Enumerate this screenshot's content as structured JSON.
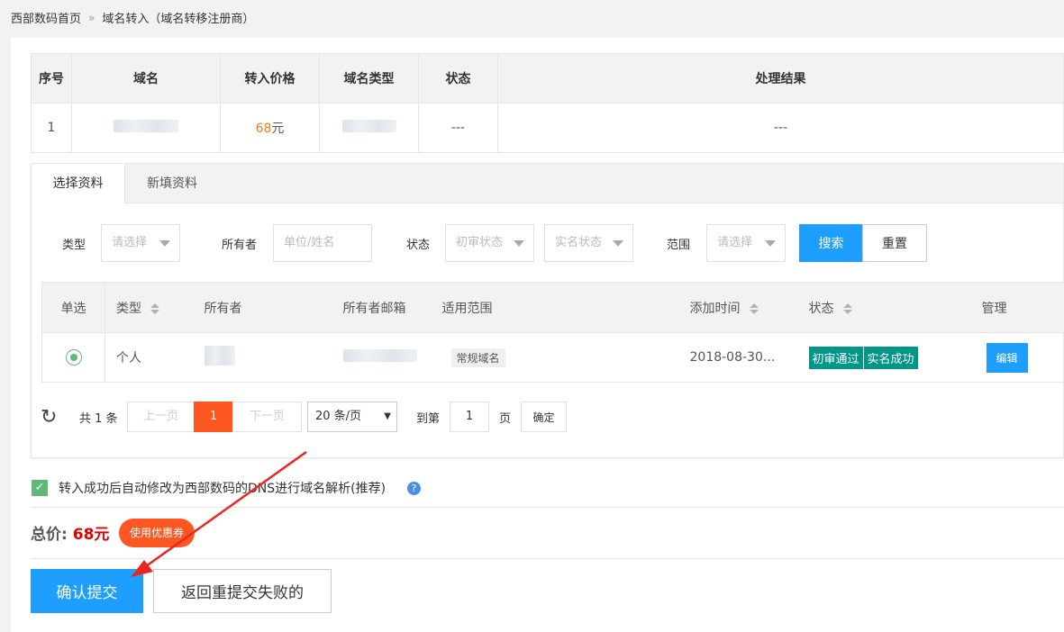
{
  "breadcrumb": {
    "home": "西部数码首页",
    "sep": "»",
    "current": "域名转入（域名转移注册商）"
  },
  "domain_table": {
    "headers": [
      "序号",
      "域名",
      "转入价格",
      "域名类型",
      "状态",
      "处理结果"
    ],
    "row": {
      "index": "1",
      "price_num": "68",
      "price_unit": "元",
      "status": "---",
      "result": "---"
    }
  },
  "tabs": [
    "选择资料",
    "新填资料"
  ],
  "filters": {
    "type_label": "类型",
    "type_placeholder": "请选择",
    "owner_label": "所有者",
    "owner_placeholder": "单位/姓名",
    "status_label": "状态",
    "status1_placeholder": "初审状态",
    "status2_placeholder": "实名状态",
    "scope_label": "范围",
    "scope_placeholder": "请选择",
    "search": "搜索",
    "reset": "重置"
  },
  "profile_table": {
    "headers": [
      "单选",
      "类型",
      "所有者",
      "所有者邮箱",
      "适用范围",
      "添加时间",
      "状态",
      "管理"
    ],
    "row": {
      "type": "个人",
      "scope": "常规域名",
      "time": "2018-08-30...",
      "status1": "初审通过",
      "status2": "实名成功",
      "edit": "编辑"
    }
  },
  "pager": {
    "total": "共 1 条",
    "prev": "上一页",
    "current": "1",
    "next": "下一页",
    "per_page": "20 条/页",
    "goto": "到第",
    "goto_value": "1",
    "page": "页",
    "confirm": "确定"
  },
  "dns_option": "转入成功后自动修改为西部数码的DNS进行域名解析(推荐)",
  "total": {
    "label": "总价:",
    "amount": "68元"
  },
  "coupon": "使用优惠券",
  "submit": "确认提交",
  "resubmit": "返回重提交失败的",
  "colors": {
    "primary": "#1e9fff",
    "orange": "#ff5722",
    "green": "#009688",
    "price": "#e40000",
    "annotation": "#e8261e"
  }
}
